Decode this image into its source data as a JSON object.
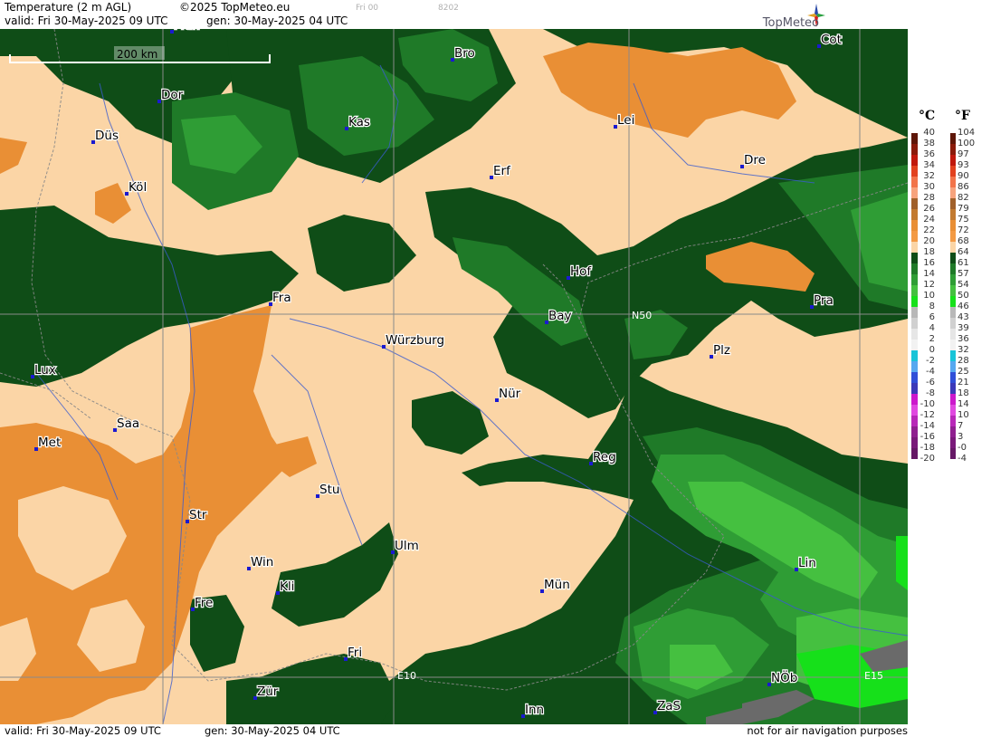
{
  "header": {
    "title": "Temperature (2 m AGL)",
    "copyright": "©2025 TopMeteo.eu",
    "valid": "valid:  Fri  30-May-2025  09 UTC",
    "generated": "gen:  30-May-2025 04 UTC",
    "run_hint": "Fri 00",
    "code_hint": "8202",
    "brand": "TopMeteo"
  },
  "footer": {
    "valid": "valid:  Fri  30-May-2025  09 UTC",
    "generated": "gen:  30-May-2025 04 UTC",
    "disclaimer": "not for air navigation purposes"
  },
  "scale_bar": {
    "label": "200 km"
  },
  "map": {
    "cities": [
      {
        "name": "Mün",
        "key": "muenster"
      },
      {
        "name": "Dor",
        "key": "dortmund"
      },
      {
        "name": "Düs",
        "key": "duesseldorf"
      },
      {
        "name": "Köl",
        "key": "koeln"
      },
      {
        "name": "Kas",
        "key": "kassel"
      },
      {
        "name": "Bro",
        "key": "brocken"
      },
      {
        "name": "Lei",
        "key": "leipzig"
      },
      {
        "name": "Cot",
        "key": "cottbus"
      },
      {
        "name": "Erf",
        "key": "erfurt"
      },
      {
        "name": "Dre",
        "key": "dresden"
      },
      {
        "name": "Hof",
        "key": "hof"
      },
      {
        "name": "Fra",
        "key": "frankfurt"
      },
      {
        "name": "Pra",
        "key": "praha"
      },
      {
        "name": "Bay",
        "key": "bayreuth"
      },
      {
        "name": "Würzburg",
        "key": "wuerzburg"
      },
      {
        "name": "Plz",
        "key": "plzen"
      },
      {
        "name": "Lux",
        "key": "luxembourg"
      },
      {
        "name": "Nür",
        "key": "nuernberg"
      },
      {
        "name": "Saa",
        "key": "saarbruecken"
      },
      {
        "name": "Met",
        "key": "metz"
      },
      {
        "name": "Reg",
        "key": "regensburg"
      },
      {
        "name": "Stu",
        "key": "stuttgart"
      },
      {
        "name": "Str",
        "key": "strasbourg"
      },
      {
        "name": "Ulm",
        "key": "ulm"
      },
      {
        "name": "Win",
        "key": "winterthur"
      },
      {
        "name": "Kli",
        "key": "klippeneck"
      },
      {
        "name": "Mün",
        "key": "muenchen"
      },
      {
        "name": "Lin",
        "key": "linz"
      },
      {
        "name": "Fre",
        "key": "freiburg"
      },
      {
        "name": "Fri",
        "key": "friedrichshafen"
      },
      {
        "name": "Zür",
        "key": "zuerich"
      },
      {
        "name": "Inn",
        "key": "innsbruck"
      },
      {
        "name": "ZaS",
        "key": "zellamsee"
      },
      {
        "name": "NÖb",
        "key": "niederoeblarn"
      }
    ],
    "grid_labels": [
      "N50",
      "E10",
      "E15"
    ]
  },
  "legend": {
    "celsius_unit": "°C",
    "fahrenheit_unit": "°F",
    "celsius_ticks": [
      "40",
      "38",
      "36",
      "34",
      "32",
      "30",
      "28",
      "26",
      "24",
      "22",
      "20",
      "18",
      "16",
      "14",
      "12",
      "10",
      "8",
      "6",
      "4",
      "2",
      "0",
      "-2",
      "-4",
      "-6",
      "-8",
      "-10",
      "-12",
      "-14",
      "-16",
      "-18",
      "-20"
    ],
    "fahrenheit_ticks": [
      "104",
      "100",
      "97",
      "93",
      "90",
      "86",
      "82",
      "79",
      "75",
      "72",
      "68",
      "64",
      "61",
      "57",
      "54",
      "50",
      "46",
      "43",
      "39",
      "36",
      "32",
      "28",
      "25",
      "21",
      "18",
      "14",
      "10",
      "7",
      "3",
      "-0",
      "-4"
    ],
    "colors": [
      "#5e1608",
      "#8a1a0a",
      "#c0180c",
      "#e2411e",
      "#f2744a",
      "#f7a37d",
      "#a0602a",
      "#c27a30",
      "#e98f35",
      "#f39a44",
      "#fbd5a6",
      "#0f4d17",
      "#1f7a28",
      "#2f9d35",
      "#45c040",
      "#16e01a",
      "#b8b8b8",
      "#d0d0d0",
      "#e6e6e6",
      "#f2f2f2",
      "#18c4d8",
      "#56a8f0",
      "#2f4fd8",
      "#3b38b8",
      "#cc18cc",
      "#e048e0",
      "#b828b8",
      "#902090",
      "#7a1a7a",
      "#661866"
    ]
  }
}
